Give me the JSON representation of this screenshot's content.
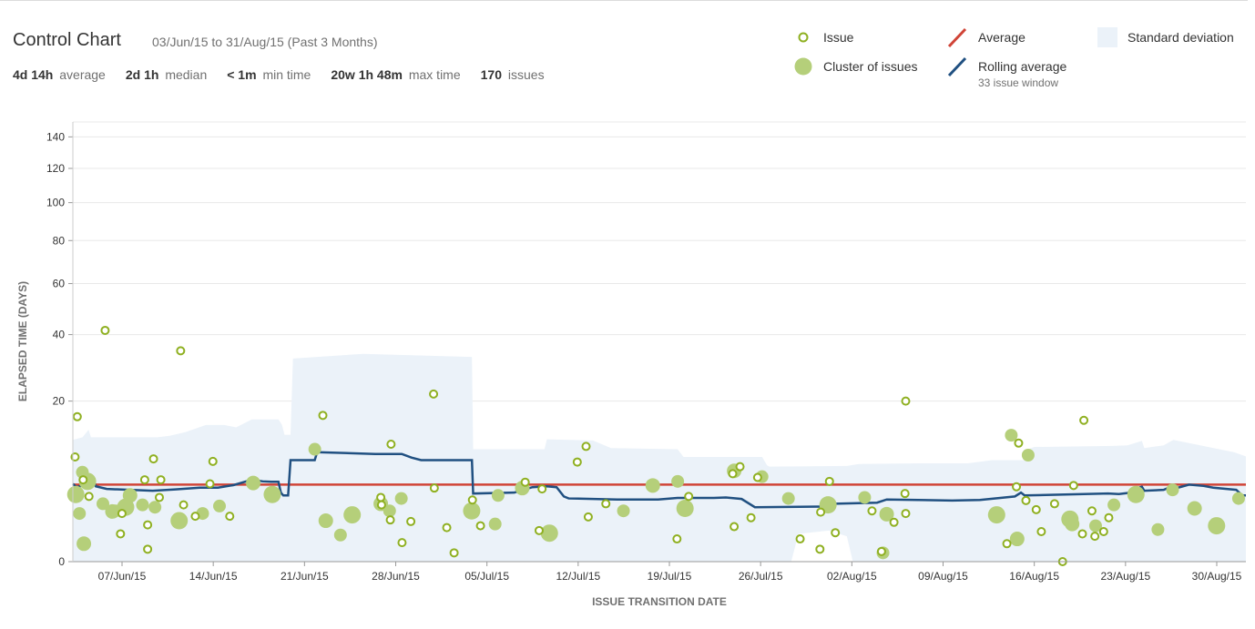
{
  "header": {
    "title": "Control Chart",
    "date_range": "03/Jun/15 to 31/Aug/15 (Past 3 Months)",
    "stats": [
      {
        "value": "4d 14h",
        "label": "average"
      },
      {
        "value": "2d 1h",
        "label": "median"
      },
      {
        "value": "< 1m",
        "label": "min time"
      },
      {
        "value": "20w 1h 48m",
        "label": "max time"
      },
      {
        "value": "170",
        "label": "issues"
      }
    ]
  },
  "legend": {
    "issue": "Issue",
    "cluster": "Cluster of issues",
    "average": "Average",
    "rolling": "Rolling average",
    "rolling_sub": "33 issue window",
    "stddev": "Standard deviation"
  },
  "colors": {
    "issue": "#8fb021",
    "cluster": "#b5cf7a",
    "average": "#d04437",
    "rolling": "#205081",
    "stddev": "#ebf2f9"
  },
  "chart_data": {
    "type": "scatter",
    "xlabel": "ISSUE TRANSITION DATE",
    "ylabel": "ELAPSED TIME (DAYS)",
    "scale": "sqrt",
    "x_range": [
      "2015-06-03",
      "2015-08-31"
    ],
    "ylim": [
      0,
      150
    ],
    "y_ticks": [
      0,
      20,
      40,
      60,
      80,
      100,
      120,
      140
    ],
    "x_ticks": [
      "07/Jun/15",
      "14/Jun/15",
      "21/Jun/15",
      "28/Jun/15",
      "05/Jul/15",
      "12/Jul/15",
      "19/Jul/15",
      "26/Jul/15",
      "02/Aug/15",
      "09/Aug/15",
      "16/Aug/15",
      "23/Aug/15",
      "30/Aug/15"
    ],
    "x_tick_days": [
      4,
      11,
      18,
      25,
      32,
      39,
      46,
      53,
      60,
      67,
      74,
      81,
      88
    ],
    "average": 4.6,
    "issues": [
      [
        0.3,
        8.5
      ],
      [
        0.6,
        16.3
      ],
      [
        1.4,
        5.2
      ],
      [
        2.2,
        3.3
      ],
      [
        4.4,
        41.5
      ],
      [
        6.5,
        0.6
      ],
      [
        6.7,
        1.8
      ],
      [
        9.8,
        5.2
      ],
      [
        10.2,
        0.12
      ],
      [
        10.2,
        1.05
      ],
      [
        11.8,
        3.2
      ],
      [
        11.0,
        8.2
      ],
      [
        12.0,
        5.2
      ],
      [
        14.7,
        34.5
      ],
      [
        15.1,
        2.5
      ],
      [
        16.7,
        1.6
      ],
      [
        18.7,
        4.7
      ],
      [
        19.1,
        7.8
      ],
      [
        21.4,
        1.6
      ],
      [
        34.1,
        16.6
      ],
      [
        42.0,
        3.2
      ],
      [
        42.1,
        2.5
      ],
      [
        43.3,
        1.35
      ],
      [
        43.4,
        10.7
      ],
      [
        44.9,
        0.28
      ],
      [
        46.1,
        1.25
      ],
      [
        49.2,
        21.8
      ],
      [
        49.3,
        4.2
      ],
      [
        51.0,
        0.9
      ],
      [
        52.0,
        0.06
      ],
      [
        54.5,
        2.95
      ],
      [
        55.6,
        1.0
      ],
      [
        61.7,
        4.9
      ],
      [
        63.6,
        0.75
      ],
      [
        64.0,
        4.1
      ],
      [
        68.8,
        7.7
      ],
      [
        70.0,
        10.3
      ],
      [
        70.3,
        1.55
      ],
      [
        72.7,
        2.6
      ],
      [
        82.4,
        0.4
      ],
      [
        84.0,
        3.3
      ],
      [
        90.2,
        0.95
      ],
      [
        90.0,
        6.0
      ],
      [
        91.0,
        7.0
      ],
      [
        92.5,
        1.5
      ],
      [
        93.4,
        5.5
      ],
      [
        99.2,
        0.4
      ],
      [
        101.9,
        0.12
      ],
      [
        102.0,
        1.9
      ],
      [
        103.2,
        5.0
      ],
      [
        104.0,
        0.65
      ],
      [
        109.0,
        2.0
      ],
      [
        110.3,
        0.08
      ],
      [
        112.0,
        1.2
      ],
      [
        113.6,
        20.0
      ],
      [
        113.5,
        3.6
      ],
      [
        113.6,
        1.8
      ],
      [
        127.4,
        0.25
      ],
      [
        128.7,
        4.35
      ],
      [
        129.0,
        10.9
      ],
      [
        130.0,
        2.9
      ],
      [
        131.4,
        2.1
      ],
      [
        132.1,
        0.7
      ],
      [
        133.9,
        2.6
      ],
      [
        135.0,
        0.0
      ],
      [
        136.5,
        4.5
      ],
      [
        137.7,
        0.6
      ],
      [
        137.9,
        15.5
      ],
      [
        139.0,
        2.0
      ],
      [
        139.4,
        0.5
      ],
      [
        140.6,
        0.7
      ],
      [
        141.3,
        1.5
      ]
    ],
    "clusters": [
      [
        0.4,
        3.5
      ],
      [
        0.9,
        1.8
      ],
      [
        1.3,
        6.2
      ],
      [
        1.5,
        0.25
      ],
      [
        2.0,
        5.0
      ],
      [
        4.1,
        2.6
      ],
      [
        5.4,
        1.95
      ],
      [
        5.8,
        2.0
      ],
      [
        7.2,
        2.3
      ],
      [
        7.8,
        3.4
      ],
      [
        9.5,
        2.5
      ],
      [
        11.2,
        2.3
      ],
      [
        14.5,
        1.3
      ],
      [
        17.7,
        1.8
      ],
      [
        20.0,
        2.4
      ],
      [
        24.6,
        4.8
      ],
      [
        27.2,
        3.5
      ],
      [
        33.0,
        9.8
      ],
      [
        34.5,
        1.3
      ],
      [
        36.5,
        0.55
      ],
      [
        38.1,
        1.7
      ],
      [
        42.0,
        2.6
      ],
      [
        43.2,
        2.0
      ],
      [
        44.8,
        3.1
      ],
      [
        54.4,
        2.0
      ],
      [
        57.6,
        1.1
      ],
      [
        58.0,
        3.4
      ],
      [
        61.3,
        4.2
      ],
      [
        65.0,
        0.63
      ],
      [
        75.1,
        2.0
      ],
      [
        79.1,
        4.5
      ],
      [
        82.5,
        5.0
      ],
      [
        83.5,
        2.2
      ],
      [
        90.2,
        6.4
      ],
      [
        94.0,
        5.6
      ],
      [
        97.6,
        3.1
      ],
      [
        103.0,
        2.5
      ],
      [
        108.0,
        3.2
      ],
      [
        110.5,
        0.06
      ],
      [
        111.0,
        1.75
      ],
      [
        126.0,
        1.7
      ],
      [
        128.0,
        12.4
      ],
      [
        128.8,
        0.4
      ],
      [
        130.3,
        8.8
      ],
      [
        136.0,
        1.4
      ],
      [
        136.3,
        1.1
      ],
      [
        139.5,
        1.0
      ],
      [
        142.0,
        2.5
      ],
      [
        145.0,
        3.5
      ],
      [
        148.0,
        0.8
      ],
      [
        150.0,
        4.0
      ],
      [
        153.0,
        2.2
      ],
      [
        156.0,
        1.0
      ],
      [
        159.0,
        3.1
      ]
    ],
    "rolling": [
      [
        0,
        4.7
      ],
      [
        0.3,
        4.3
      ],
      [
        0.8,
        4.5
      ],
      [
        1.6,
        5.4
      ],
      [
        1.9,
        4.4
      ],
      [
        2.8,
        4.1
      ],
      [
        6.6,
        3.9
      ],
      [
        8.5,
        4.05
      ],
      [
        10.5,
        4.25
      ],
      [
        12.0,
        4.25
      ],
      [
        13.3,
        4.55
      ],
      [
        14.8,
        5.2
      ],
      [
        15.7,
        5.0
      ],
      [
        16.4,
        4.95
      ],
      [
        17.0,
        4.95
      ],
      [
        17.2,
        3.7
      ],
      [
        17.4,
        3.4
      ],
      [
        17.8,
        3.4
      ],
      [
        18.0,
        8.0
      ],
      [
        20.0,
        8.0
      ],
      [
        20.2,
        9.3
      ],
      [
        25.0,
        9.0
      ],
      [
        27.2,
        9.0
      ],
      [
        28.0,
        8.4
      ],
      [
        28.8,
        8.0
      ],
      [
        32.0,
        8.0
      ],
      [
        33.0,
        8.0
      ],
      [
        33.1,
        3.6
      ],
      [
        36.5,
        3.7
      ],
      [
        38.0,
        4.3
      ],
      [
        39.2,
        4.4
      ],
      [
        40.0,
        4.3
      ],
      [
        40.6,
        3.3
      ],
      [
        41.0,
        3.1
      ],
      [
        45.0,
        3.0
      ],
      [
        48.4,
        3.0
      ],
      [
        50.0,
        3.15
      ],
      [
        53.0,
        3.15
      ],
      [
        54.0,
        3.2
      ],
      [
        55.3,
        3.05
      ],
      [
        56.4,
        2.3
      ],
      [
        62.0,
        2.35
      ],
      [
        63.0,
        2.6
      ],
      [
        66.5,
        2.7
      ],
      [
        67.3,
        3.0
      ],
      [
        72.7,
        2.9
      ],
      [
        75.0,
        2.95
      ],
      [
        77.9,
        3.3
      ],
      [
        78.4,
        3.7
      ],
      [
        78.7,
        3.4
      ],
      [
        85.6,
        3.6
      ],
      [
        86.5,
        3.55
      ],
      [
        87.2,
        3.65
      ],
      [
        87.8,
        4.1
      ],
      [
        88.4,
        4.35
      ],
      [
        88.6,
        3.9
      ],
      [
        90.2,
        4.0
      ],
      [
        90.7,
        4.3
      ],
      [
        91.4,
        4.25
      ],
      [
        92.3,
        4.6
      ],
      [
        93.5,
        4.45
      ],
      [
        94.3,
        4.25
      ],
      [
        96.2,
        4.0
      ],
      [
        96.7,
        3.4
      ],
      [
        97.0,
        3.4
      ]
    ],
    "stddev_upper": [
      [
        0,
        11.5
      ],
      [
        0.8,
        12.0
      ],
      [
        1.3,
        13.5
      ],
      [
        1.5,
        12.0
      ],
      [
        7.0,
        12.0
      ],
      [
        8.0,
        12.3
      ],
      [
        9.3,
        13.0
      ],
      [
        11.0,
        14.5
      ],
      [
        12.5,
        14.5
      ],
      [
        13.5,
        14.0
      ],
      [
        14.8,
        15.7
      ],
      [
        17.0,
        15.7
      ],
      [
        17.3,
        14.5
      ],
      [
        17.5,
        12.5
      ],
      [
        18.0,
        12.5
      ],
      [
        18.2,
        32.0
      ],
      [
        24.0,
        33.5
      ],
      [
        33.0,
        32.5
      ],
      [
        33.1,
        9.8
      ],
      [
        39.0,
        9.8
      ],
      [
        39.2,
        11.6
      ],
      [
        43.0,
        11.4
      ],
      [
        44.5,
        10.0
      ],
      [
        50.0,
        9.8
      ],
      [
        50.5,
        8.5
      ],
      [
        57.0,
        8.5
      ],
      [
        57.4,
        7.2
      ],
      [
        57.6,
        7.0
      ],
      [
        64.0,
        7.1
      ],
      [
        65.0,
        7.4
      ],
      [
        70.0,
        7.5
      ],
      [
        74.0,
        7.5
      ],
      [
        76.0,
        8.0
      ],
      [
        78.8,
        8.0
      ],
      [
        79.0,
        9.8
      ],
      [
        79.5,
        10.2
      ],
      [
        86.0,
        10.4
      ],
      [
        87.2,
        10.5
      ],
      [
        88.4,
        11.3
      ],
      [
        88.6,
        10.0
      ],
      [
        90.2,
        10.5
      ],
      [
        91.0,
        11.5
      ],
      [
        96.0,
        9.3
      ],
      [
        97.0,
        8.6
      ]
    ],
    "stddev_lower": [
      [
        0,
        0
      ],
      [
        59.4,
        0
      ],
      [
        59.4,
        0
      ],
      [
        59.7,
        0.15
      ],
      [
        60.0,
        0.6
      ],
      [
        62.5,
        0.75
      ],
      [
        64.0,
        0.5
      ],
      [
        64.5,
        0.0
      ],
      [
        97.0,
        0
      ]
    ]
  }
}
